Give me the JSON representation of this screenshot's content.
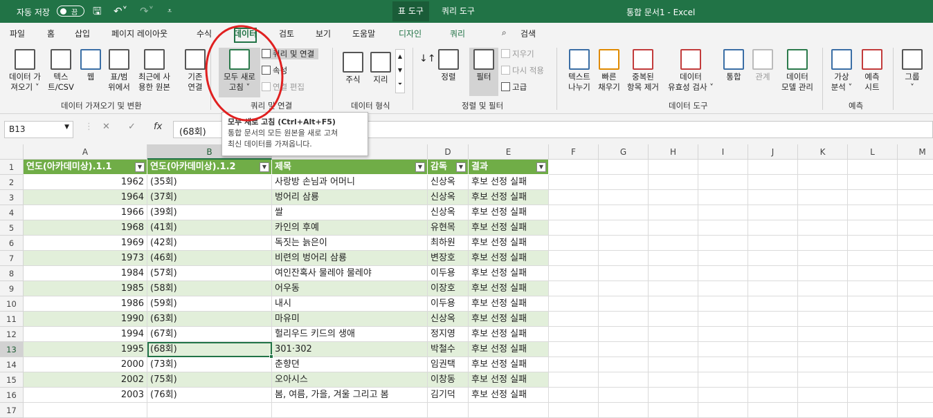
{
  "titlebar": {
    "autosave_label": "자동 저장",
    "autosave_state": "끔",
    "context_tabs": [
      "표 도구",
      "쿼리 도구"
    ],
    "document_title": "통합 문서1  -  Excel"
  },
  "tabs": {
    "items": [
      "파일",
      "홈",
      "삽입",
      "페이지 레이아웃",
      "수식",
      "데이터",
      "검토",
      "보기",
      "도움말",
      "디자인",
      "쿼리"
    ],
    "active": "데이터",
    "search": "검색"
  },
  "ribbon": {
    "get_data": [
      "데이터 가",
      "져오기 ˅"
    ],
    "text_csv": [
      "텍스",
      "트/CSV"
    ],
    "web": "웹",
    "from_table": [
      "표/범",
      "위에서"
    ],
    "recent": [
      "최근에 사",
      "용한 원본"
    ],
    "existing": [
      "기존",
      "연결"
    ],
    "refresh_all": [
      "모두 새로",
      "고침 ˅"
    ],
    "queries_connections": "쿼리 및 연결",
    "properties": "속성",
    "edit_links": "연결 편집",
    "stocks": "주식",
    "geography": "지리",
    "sort_az": "↓",
    "sort": "정렬",
    "filter": "필터",
    "clear": "지우기",
    "reapply": "다시 적용",
    "advanced": "고급",
    "text_to_columns": [
      "텍스트",
      "나누기"
    ],
    "flash_fill": [
      "빠른",
      "채우기"
    ],
    "remove_duplicates": [
      "중복된",
      "항목 제거"
    ],
    "data_validation": [
      "데이터",
      "유효성 검사 ˅"
    ],
    "consolidate": "통합",
    "relationships": "관계",
    "data_model": [
      "데이터",
      "모델 관리"
    ],
    "what_if": [
      "가상",
      "분석 ˅"
    ],
    "forecast": [
      "예측",
      "시트"
    ],
    "group": [
      "그룹",
      "˅"
    ],
    "groups": [
      "데이터 가져오기 및 변환",
      "쿼리 및 연결",
      "데이터 형식",
      "정렬 및 필터",
      "데이터 도구",
      "예측"
    ]
  },
  "formula_bar": {
    "name_box": "B13",
    "cancel": "✕",
    "enter": "✓",
    "fx": "fx",
    "value": "(68회)"
  },
  "tooltip": {
    "title": "모두 새로 고침 (Ctrl+Alt+F5)",
    "desc": [
      "통합 문서의 모든 원본을 새로 고쳐",
      "최신 데이터를 가져옵니다."
    ]
  },
  "grid": {
    "columns": [
      "A",
      "B",
      "C",
      "D",
      "E",
      "F",
      "G",
      "H",
      "I",
      "J",
      "K",
      "L",
      "M"
    ],
    "selected_column": "B",
    "selected_row": 13,
    "headers": [
      "연도(아카데미상).1.1",
      "연도(아카데미상).1.2",
      "제목",
      "감독",
      "결과"
    ],
    "rows": [
      {
        "n": 2,
        "a": "1962",
        "b": "(35회)",
        "c": "사랑방 손님과 어머니",
        "d": "신상옥",
        "e": "후보 선정 실패"
      },
      {
        "n": 3,
        "a": "1964",
        "b": "(37회)",
        "c": "벙어리 삼룡",
        "d": "신상옥",
        "e": "후보 선정 실패"
      },
      {
        "n": 4,
        "a": "1966",
        "b": "(39회)",
        "c": "쌀",
        "d": "신상옥",
        "e": "후보 선정 실패"
      },
      {
        "n": 5,
        "a": "1968",
        "b": "(41회)",
        "c": "카인의 후예",
        "d": "유현목",
        "e": "후보 선정 실패"
      },
      {
        "n": 6,
        "a": "1969",
        "b": "(42회)",
        "c": "독짓는 늙은이",
        "d": "최하원",
        "e": "후보 선정 실패"
      },
      {
        "n": 7,
        "a": "1973",
        "b": "(46회)",
        "c": "비련의 벙어리 삼룡",
        "d": "변장호",
        "e": "후보 선정 실패"
      },
      {
        "n": 8,
        "a": "1984",
        "b": "(57회)",
        "c": "여인잔혹사 물레야 물레야",
        "d": "이두용",
        "e": "후보 선정 실패"
      },
      {
        "n": 9,
        "a": "1985",
        "b": "(58회)",
        "c": "어우동",
        "d": "이장호",
        "e": "후보 선정 실패"
      },
      {
        "n": 10,
        "a": "1986",
        "b": "(59회)",
        "c": "내시",
        "d": "이두용",
        "e": "후보 선정 실패"
      },
      {
        "n": 11,
        "a": "1990",
        "b": "(63회)",
        "c": "마유미",
        "d": "신상옥",
        "e": "후보 선정 실패"
      },
      {
        "n": 12,
        "a": "1994",
        "b": "(67회)",
        "c": "헐리우드 키드의 생애",
        "d": "정지영",
        "e": "후보 선정 실패"
      },
      {
        "n": 13,
        "a": "1995",
        "b": "(68회)",
        "c": "301·302",
        "d": "박철수",
        "e": "후보 선정 실패"
      },
      {
        "n": 14,
        "a": "2000",
        "b": "(73회)",
        "c": "춘향뎐",
        "d": "임권택",
        "e": "후보 선정 실패"
      },
      {
        "n": 15,
        "a": "2002",
        "b": "(75회)",
        "c": "오아시스",
        "d": "이창동",
        "e": "후보 선정 실패"
      },
      {
        "n": 16,
        "a": "2003",
        "b": "(76회)",
        "c": "봄, 여름, 가을, 겨울 그리고 봄",
        "d": "김기덕",
        "e": "후보 선정 실패"
      },
      {
        "n": 17,
        "a": "",
        "b": "",
        "c": "",
        "d": "",
        "e": ""
      }
    ]
  }
}
